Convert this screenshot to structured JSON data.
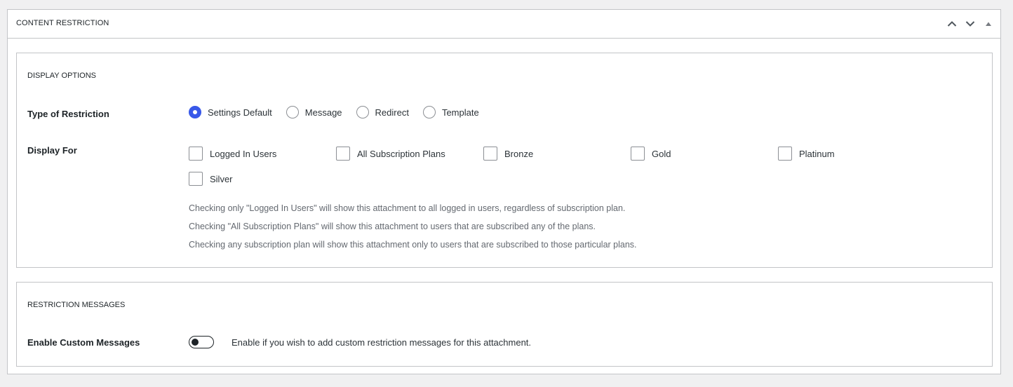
{
  "metabox": {
    "title": "CONTENT RESTRICTION",
    "actions": [
      {
        "name": "move-up-button",
        "icon": "chevron-up-icon"
      },
      {
        "name": "move-down-button",
        "icon": "chevron-down-icon"
      },
      {
        "name": "toggle-panel-button",
        "icon": "triangle-up-icon"
      }
    ]
  },
  "display_options": {
    "title": "DISPLAY OPTIONS",
    "type_label": "Type of Restriction",
    "types": [
      {
        "label": "Settings Default",
        "checked": true
      },
      {
        "label": "Message",
        "checked": false
      },
      {
        "label": "Redirect",
        "checked": false
      },
      {
        "label": "Template",
        "checked": false
      }
    ],
    "display_for_label": "Display For",
    "display_for": [
      {
        "label": "Logged In Users",
        "checked": false
      },
      {
        "label": "All Subscription Plans",
        "checked": false
      },
      {
        "label": "Bronze",
        "checked": false
      },
      {
        "label": "Gold",
        "checked": false
      },
      {
        "label": "Platinum",
        "checked": false
      },
      {
        "label": "Silver",
        "checked": false
      }
    ],
    "help": [
      "Checking only \"Logged In Users\" will show this attachment to all logged in users, regardless of subscription plan.",
      "Checking \"All Subscription Plans\" will show this attachment to users that are subscribed any of the plans.",
      "Checking any subscription plan will show this attachment only to users that are subscribed to those particular plans."
    ]
  },
  "restriction_messages": {
    "title": "RESTRICTION MESSAGES",
    "enable_label": "Enable Custom Messages",
    "enabled": false,
    "enable_description": "Enable if you wish to add custom restriction messages for this attachment."
  },
  "colors": {
    "accent": "#3858e9",
    "background": "#f0f0f1",
    "border": "#c3c4c7"
  }
}
